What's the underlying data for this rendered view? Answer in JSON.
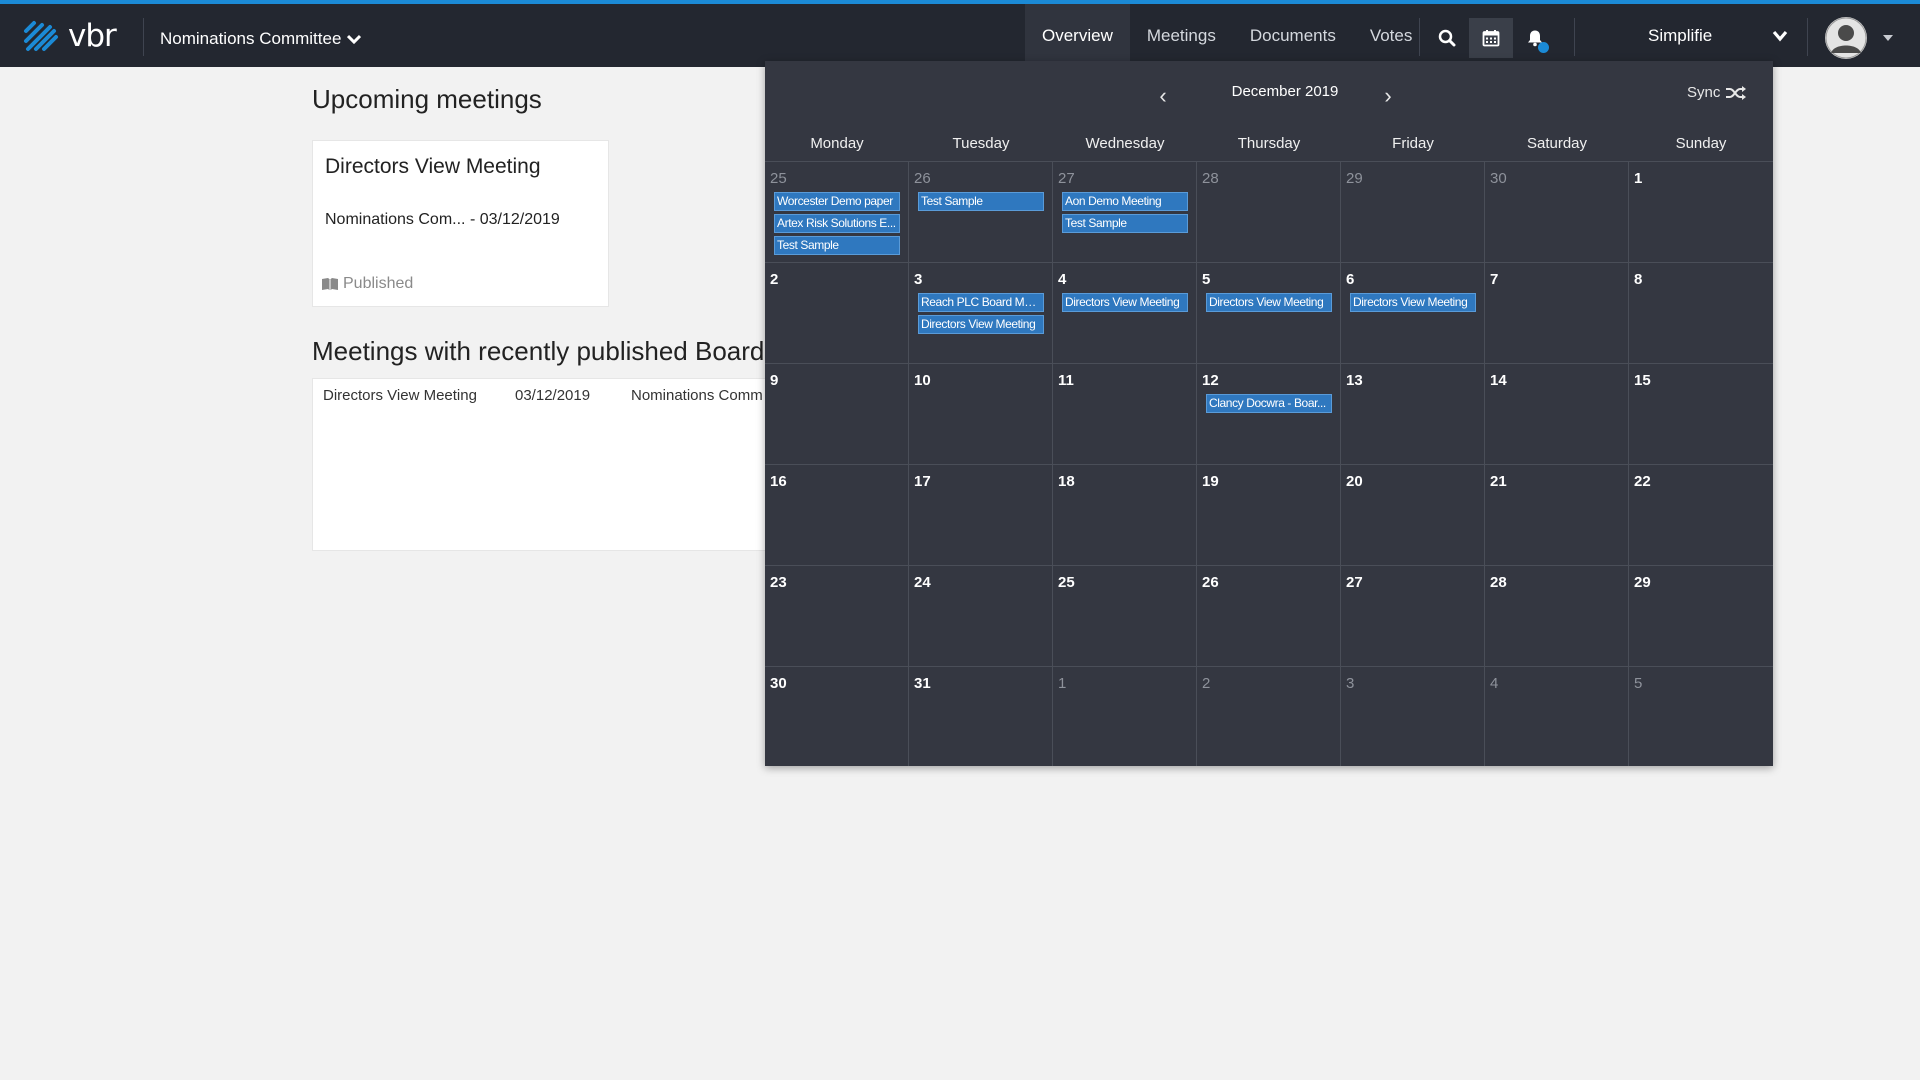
{
  "header": {
    "logo_text": "vbr",
    "committee": "Nominations Committee",
    "nav": [
      "Overview",
      "Meetings",
      "Documents",
      "Votes"
    ],
    "active_nav": "Overview",
    "user_name": "Simplifie",
    "accent_color": "#1b8ad6"
  },
  "upcoming": {
    "heading": "Upcoming meetings",
    "card": {
      "title": "Directors View Meeting",
      "subtitle": "Nominations Com... - 03/12/2019",
      "status": "Published"
    }
  },
  "recent": {
    "heading": "Meetings with recently published Board",
    "row": {
      "name": "Directors View Meeting",
      "date": "03/12/2019",
      "committee": "Nominations Comm"
    }
  },
  "calendar": {
    "month_label": "December 2019",
    "sync_label": "Sync",
    "prev_symbol": "‹",
    "next_symbol": "›",
    "days_of_week": [
      "Monday",
      "Tuesday",
      "Wednesday",
      "Thursday",
      "Friday",
      "Saturday",
      "Sunday"
    ],
    "event_color": "#2f78bf",
    "weeks": [
      [
        {
          "day": "25",
          "other": true,
          "events": [
            "Worcester Demo paper",
            "Artex Risk Solutions E...",
            "Test Sample"
          ]
        },
        {
          "day": "26",
          "other": true,
          "events": [
            "Test Sample"
          ]
        },
        {
          "day": "27",
          "other": true,
          "events": [
            "Aon Demo Meeting",
            "Test Sample"
          ]
        },
        {
          "day": "28",
          "other": true,
          "events": []
        },
        {
          "day": "29",
          "other": true,
          "events": []
        },
        {
          "day": "30",
          "other": true,
          "events": []
        },
        {
          "day": "1",
          "other": false,
          "events": []
        }
      ],
      [
        {
          "day": "2",
          "other": false,
          "events": []
        },
        {
          "day": "3",
          "other": false,
          "events": [
            "Reach PLC Board Mee...",
            "Directors View Meeting"
          ]
        },
        {
          "day": "4",
          "other": false,
          "events": [
            "Directors View Meeting"
          ]
        },
        {
          "day": "5",
          "other": false,
          "events": [
            "Directors View Meeting"
          ]
        },
        {
          "day": "6",
          "other": false,
          "events": [
            "Directors View Meeting"
          ]
        },
        {
          "day": "7",
          "other": false,
          "events": []
        },
        {
          "day": "8",
          "other": false,
          "events": []
        }
      ],
      [
        {
          "day": "9",
          "other": false,
          "events": []
        },
        {
          "day": "10",
          "other": false,
          "events": []
        },
        {
          "day": "11",
          "other": false,
          "events": []
        },
        {
          "day": "12",
          "other": false,
          "events": [
            "Clancy Docwra - Boar..."
          ]
        },
        {
          "day": "13",
          "other": false,
          "events": []
        },
        {
          "day": "14",
          "other": false,
          "events": []
        },
        {
          "day": "15",
          "other": false,
          "events": []
        }
      ],
      [
        {
          "day": "16",
          "other": false,
          "events": []
        },
        {
          "day": "17",
          "other": false,
          "events": []
        },
        {
          "day": "18",
          "other": false,
          "events": []
        },
        {
          "day": "19",
          "other": false,
          "events": []
        },
        {
          "day": "20",
          "other": false,
          "events": []
        },
        {
          "day": "21",
          "other": false,
          "events": []
        },
        {
          "day": "22",
          "other": false,
          "events": []
        }
      ],
      [
        {
          "day": "23",
          "other": false,
          "events": []
        },
        {
          "day": "24",
          "other": false,
          "events": []
        },
        {
          "day": "25",
          "other": false,
          "events": []
        },
        {
          "day": "26",
          "other": false,
          "events": []
        },
        {
          "day": "27",
          "other": false,
          "events": []
        },
        {
          "day": "28",
          "other": false,
          "events": []
        },
        {
          "day": "29",
          "other": false,
          "events": []
        }
      ],
      [
        {
          "day": "30",
          "other": false,
          "events": []
        },
        {
          "day": "31",
          "other": false,
          "events": []
        },
        {
          "day": "1",
          "other": true,
          "events": []
        },
        {
          "day": "2",
          "other": true,
          "events": []
        },
        {
          "day": "3",
          "other": true,
          "events": []
        },
        {
          "day": "4",
          "other": true,
          "events": []
        },
        {
          "day": "5",
          "other": true,
          "events": []
        }
      ]
    ]
  }
}
